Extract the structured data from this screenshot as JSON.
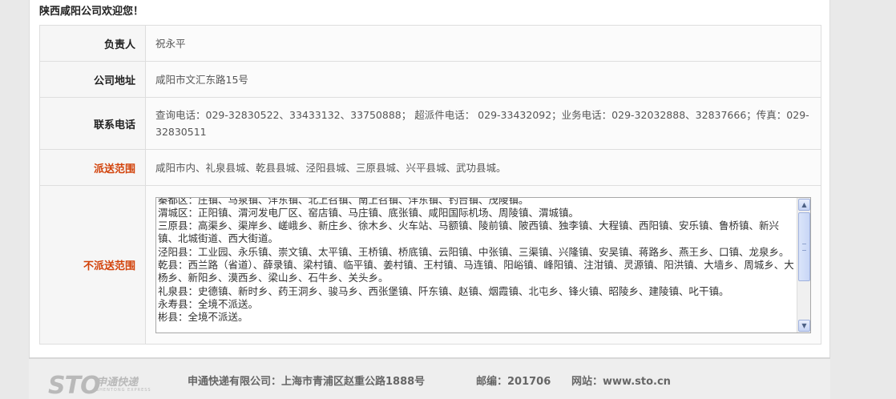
{
  "header": {
    "welcome": "陕西咸阳公司欢迎您！"
  },
  "rows": [
    {
      "label": "负责人",
      "value": "祝永平"
    },
    {
      "label": "公司地址",
      "value": "咸阳市文汇东路15号"
    },
    {
      "label": "联系电话",
      "value": "查询电话：029-32830522、33433132、33750888； 超派件电话： 029-33432092；业务电话：029-32032888、32837666；传真：029-32830511"
    },
    {
      "label": "派送范围",
      "value": "咸阳市内、礼泉县城、乾县县城、泾阳县城、三原县城、兴平县城、武功县城。"
    },
    {
      "label": "不派送范围"
    }
  ],
  "no_delivery_lines": [
    "秦都区：庄镇、马泉镇、沣东镇、北上召镇、南上召镇、沣东镇、钓台镇、茂陵镇。",
    "渭城区：正阳镇、渭河发电厂区、窑店镇、马庄镇、底张镇、咸阳国际机场、周陵镇、渭城镇。",
    "三原县：高渠乡、渠岸乡、嵯峨乡、新庄乡、徐木乡、火车站、马额镇、陵前镇、陂西镇、独李镇、大程镇、西阳镇、安乐镇、鲁桥镇、新兴镇、北城街道、西大街道。",
    "泾阳县：工业园、永乐镇、崇文镇、太平镇、王桥镇、桥底镇、云阳镇、中张镇、三渠镇、兴隆镇、安吴镇、蒋路乡、燕王乡、口镇、龙泉乡。",
    "乾县：西兰路（省道）、薛录镇、梁村镇、临平镇、姜村镇、王村镇、马连镇、阳峪镇、峰阳镇、注泔镇、灵源镇、阳洪镇、大墙乡、周城乡、大杨乡、新阳乡、漠西乡、梁山乡、石牛乡、关头乡。",
    "礼泉县：史德镇、新时乡、药王洞乡、骏马乡、西张堡镇、阡东镇、赵镇、烟霞镇、北屯乡、锋火镇、昭陵乡、建陵镇、叱干镇。",
    "永寿县：全境不派送。",
    "彬县：全境不派送。"
  ],
  "footer": {
    "logo_text": "STO",
    "logo_cn": "申通快递",
    "logo_en": "SHENTONG EXPRESS",
    "company": "申通快递有限公司：上海市青浦区赵重公路1888号",
    "postcode": "邮编：201706",
    "website": "网站：www.sto.cn"
  },
  "colors": {
    "accent_red": "#d2420a"
  }
}
